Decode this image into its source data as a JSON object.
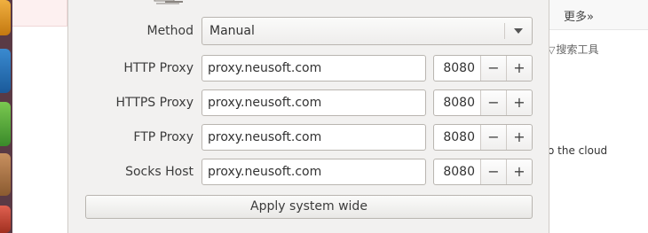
{
  "background": {
    "more_link": "更多»",
    "search_tools": "搜索工具",
    "funnel_icon": "▽",
    "cloud_text": "o the cloud"
  },
  "dialog": {
    "method": {
      "label": "Method",
      "value": "Manual"
    },
    "proxies": [
      {
        "label": "HTTP Proxy",
        "host": "proxy.neusoft.com",
        "port": "8080"
      },
      {
        "label": "HTTPS Proxy",
        "host": "proxy.neusoft.com",
        "port": "8080"
      },
      {
        "label": "FTP Proxy",
        "host": "proxy.neusoft.com",
        "port": "8080"
      },
      {
        "label": "Socks Host",
        "host": "proxy.neusoft.com",
        "port": "8080"
      }
    ],
    "spin_minus": "−",
    "spin_plus": "+",
    "apply_label": "Apply system wide"
  }
}
